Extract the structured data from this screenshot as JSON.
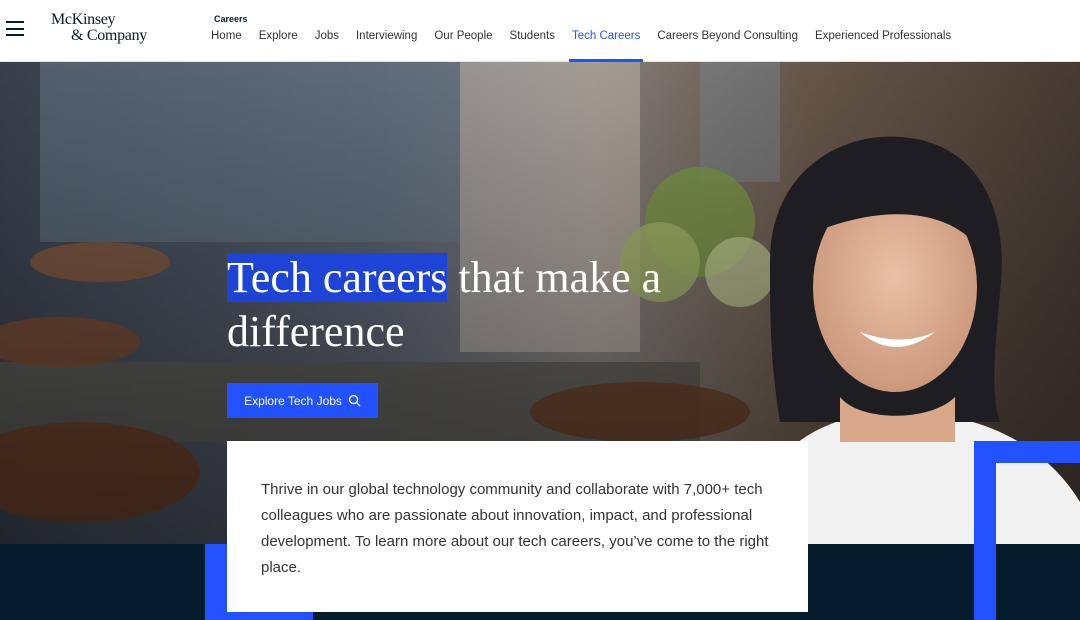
{
  "header": {
    "logo_line1": "McKinsey",
    "logo_line2": "& Company",
    "section_label": "Careers",
    "nav": [
      {
        "label": "Home"
      },
      {
        "label": "Explore"
      },
      {
        "label": "Jobs"
      },
      {
        "label": "Interviewing"
      },
      {
        "label": "Our People"
      },
      {
        "label": "Students"
      },
      {
        "label": "Tech Careers",
        "active": true
      },
      {
        "label": "Careers Beyond Consulting"
      },
      {
        "label": "Experienced Professionals"
      }
    ]
  },
  "hero": {
    "headline_highlight": "Tech careers",
    "headline_rest": " that make a",
    "headline_line2": "difference",
    "cta_label": "Explore Tech Jobs",
    "cta_icon": "search-icon",
    "intro": "Thrive in our global technology community and collaborate with 7,000+ tech colleagues who are passionate about innovation, impact, and professional development. To learn more about our tech careers, you’ve come to the right place."
  },
  "colors": {
    "brand_blue": "#2251ff",
    "navy": "#051c2c",
    "highlight": "#1d44d6"
  }
}
